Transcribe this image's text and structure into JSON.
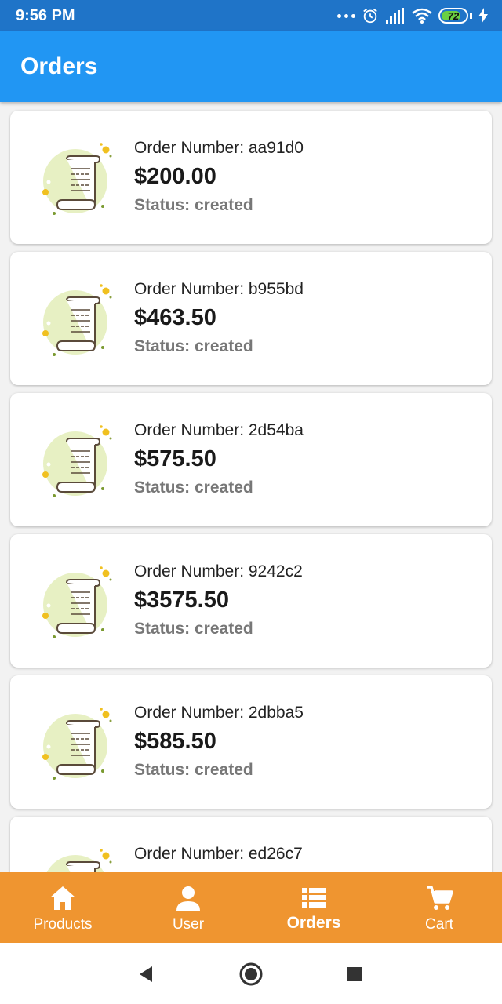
{
  "status_bar": {
    "time": "9:56 PM",
    "battery": "72"
  },
  "app_bar": {
    "title": "Orders"
  },
  "orders": [
    {
      "number": "Order Number: aa91d0",
      "total": "$200.00",
      "status": "Status: created"
    },
    {
      "number": "Order Number: b955bd",
      "total": "$463.50",
      "status": "Status: created"
    },
    {
      "number": "Order Number: 2d54ba",
      "total": "$575.50",
      "status": "Status: created"
    },
    {
      "number": "Order Number: 9242c2",
      "total": "$3575.50",
      "status": "Status: created"
    },
    {
      "number": "Order Number: 2dbba5",
      "total": "$585.50",
      "status": "Status: created"
    },
    {
      "number": "Order Number: ed26c7",
      "total": "",
      "status": ""
    }
  ],
  "bottom_nav": {
    "items": [
      {
        "label": "Products",
        "icon": "home-icon"
      },
      {
        "label": "User",
        "icon": "person-icon"
      },
      {
        "label": "Orders",
        "icon": "list-icon",
        "active": true
      },
      {
        "label": "Cart",
        "icon": "cart-icon"
      }
    ]
  },
  "colors": {
    "status_bar": "#1f74c8",
    "app_bar": "#2196f3",
    "bottom_nav": "#ef9530",
    "background": "#f2f2f2"
  }
}
